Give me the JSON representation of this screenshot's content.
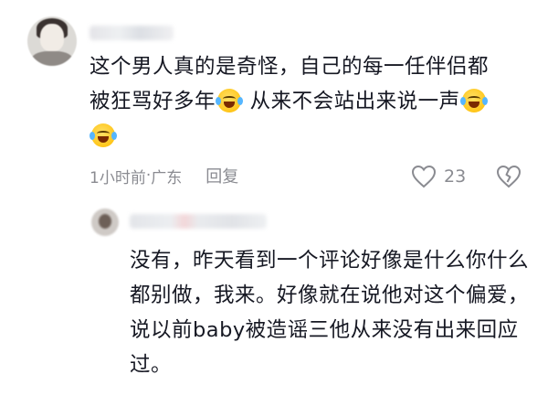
{
  "comment": {
    "text_line1": "这个男人真的是奇怪，自己的每一任伴侣都",
    "text_line2a": "被狂骂好多年",
    "text_line2b": " 从来不会站出来说一声",
    "time": "1小时前",
    "separator": " · ",
    "location": "广东",
    "reply_label": "回复",
    "likes": "23",
    "emoji_name": "laughing-crying-emoji"
  },
  "reply": {
    "text": "没有，昨天看到一个评论好像是什么你什么都别做，我来。好像就在说他对这个偏爱，说以前baby被造谣三他从来没有出来回应过。"
  },
  "icons": {
    "like": "heart-outline-icon",
    "dislike": "broken-heart-outline-icon"
  },
  "colors": {
    "text": "#161823",
    "meta": "#8a8b91",
    "background": "#ffffff"
  }
}
